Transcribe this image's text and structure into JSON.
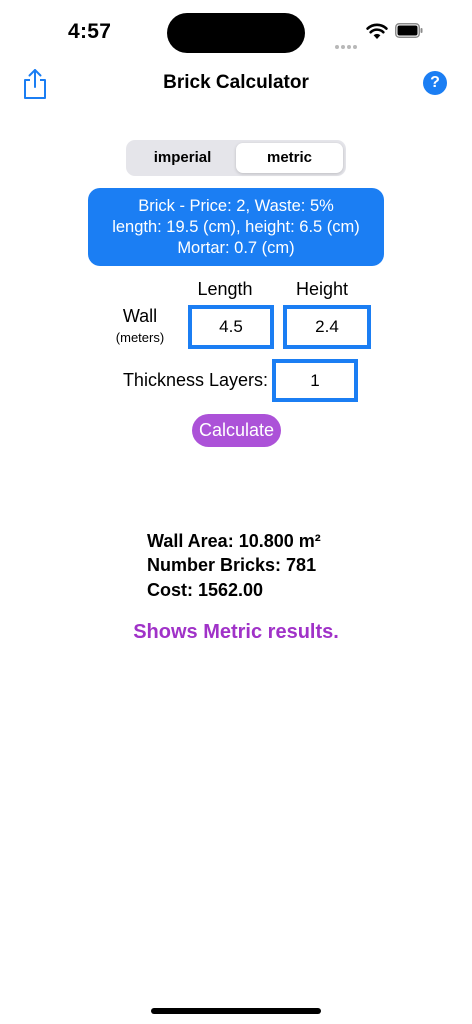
{
  "status": {
    "time": "4:57"
  },
  "nav": {
    "title": "Brick Calculator",
    "help_label": "?"
  },
  "units": {
    "options": [
      "imperial",
      "metric"
    ],
    "selected": "metric"
  },
  "info": {
    "line1": "Brick - Price: 2, Waste: 5%",
    "line2": "length: 19.5 (cm), height: 6.5 (cm)",
    "line3": "Mortar: 0.7 (cm)"
  },
  "wall": {
    "label": "Wall",
    "unit_label": "(meters)",
    "length_header": "Length",
    "height_header": "Height",
    "length_value": "4.5",
    "height_value": "2.4"
  },
  "thickness": {
    "label": "Thickness Layers:",
    "value": "1"
  },
  "calculate_label": "Calculate",
  "results": {
    "area": "Wall Area: 10.800 m²",
    "bricks": "Number Bricks: 781",
    "cost": "Cost: 1562.00"
  },
  "note": "Shows Metric results.",
  "colors": {
    "accent_blue": "#1b7ef3",
    "calc_purple": "#ac52d8",
    "note_purple": "#a032c8"
  }
}
